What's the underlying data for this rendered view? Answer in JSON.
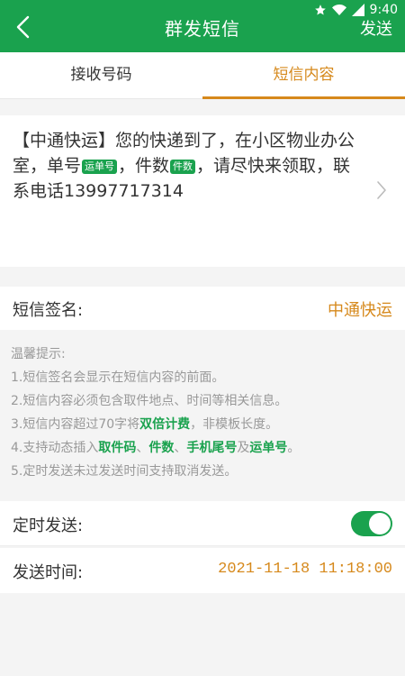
{
  "status_bar": {
    "time": "9:40"
  },
  "header": {
    "title": "群发短信",
    "send_label": "发送"
  },
  "tabs": [
    {
      "label": "接收号码",
      "active": false
    },
    {
      "label": "短信内容",
      "active": true
    }
  ],
  "message": {
    "part1": "【中通快运】您的快递到了，在小区物业办公室，单号",
    "tag_tracking": "运单号",
    "part2": "，件数",
    "tag_count": "件数",
    "part3": "，请尽快来领取，联系电话13997717314"
  },
  "signature": {
    "label": "短信签名:",
    "value": "中通快运"
  },
  "tips": {
    "title": "温馨提示:",
    "line1": "1.短信签名会显示在短信内容的前面。",
    "line2": "2.短信内容必须包含取件地点、时间等相关信息。",
    "line3_a": "3.短信内容超过70字将",
    "line3_hl": "双倍计费",
    "line3_b": "，非模板长度。",
    "line4_a": "4.支持动态插入",
    "line4_hl1": "取件码",
    "line4_sep1": "、",
    "line4_hl2": "件数",
    "line4_sep2": "、",
    "line4_hl3": "手机尾号",
    "line4_sep3": "及",
    "line4_hl4": "运单号",
    "line4_end": "。",
    "line5": "5.定时发送未过发送时间支持取消发送。"
  },
  "schedule": {
    "label": "定时发送:",
    "enabled": true
  },
  "send_time": {
    "label": "发送时间:",
    "value": "2021-11-18 11:18:00"
  },
  "colors": {
    "primary": "#1aa24e",
    "accent": "#d6891c"
  }
}
